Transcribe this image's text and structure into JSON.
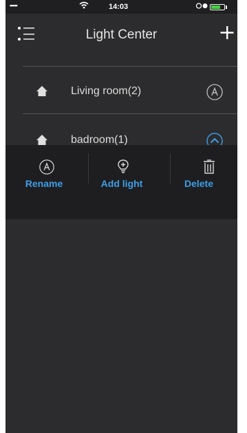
{
  "status_bar": {
    "signal": "•••••",
    "time": "14:03",
    "battery_level": 0.7
  },
  "header": {
    "title": "Light Center"
  },
  "rooms": [
    {
      "name": "Living room(2)",
      "icon": "home-icon",
      "action_icon": "circle-a-icon",
      "expanded": false
    },
    {
      "name": "badroom(1)",
      "icon": "home-icon",
      "action_icon": "circle-chevron-up-icon",
      "expanded": true
    }
  ],
  "actions": [
    {
      "label": "Rename",
      "icon": "circle-a-icon"
    },
    {
      "label": "Add light",
      "icon": "bulb-plus-icon"
    },
    {
      "label": "Delete",
      "icon": "trash-icon"
    }
  ],
  "colors": {
    "background": "#2c2c2e",
    "panel": "#1e1e20",
    "accent": "#3e9ee8",
    "text": "#dcdcdc",
    "battery": "#3fd33f"
  }
}
